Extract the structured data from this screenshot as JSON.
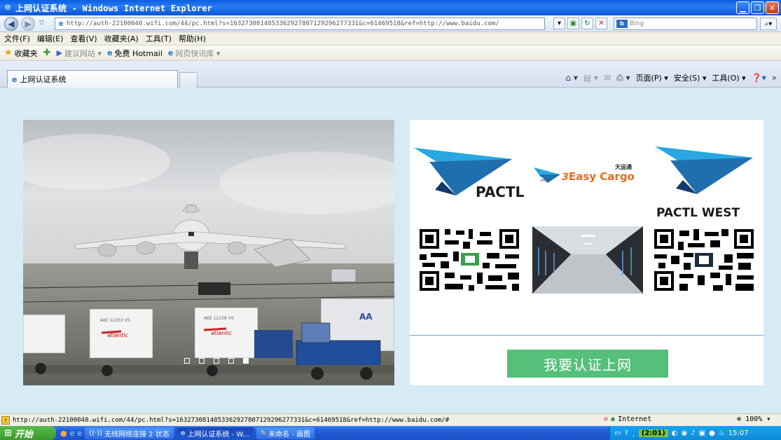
{
  "window": {
    "title": "上网认证系统 - Windows Internet Explorer",
    "controls": [
      "minimize",
      "restore",
      "close"
    ]
  },
  "address_bar": {
    "url": "http://auth-22100040.wifi.com/44/pc.html?s=1632730814853362927807129296277331&c=61469518&ref=http://www.baidu.com/",
    "search_engine": "Bing"
  },
  "menu": {
    "items": [
      "文件(F)",
      "编辑(E)",
      "查看(V)",
      "收藏夹(A)",
      "工具(T)",
      "帮助(H)"
    ]
  },
  "favorites_bar": {
    "favorites_label": "收藏夹",
    "links": [
      "建议网站 ▾",
      "免费 Hotmail",
      "网页快讯库 ▾"
    ]
  },
  "tab": {
    "title": "上网认证系统"
  },
  "command_bar": {
    "page_label": "页面(P) ▾",
    "safety_label": "安全(S) ▾",
    "tools_label": "工具(O) ▾"
  },
  "content": {
    "slider_dots": 5,
    "slider_active_index": 4,
    "logos": {
      "pactl": "PACTL",
      "easy_cargo": "Easy Cargo",
      "easy_cargo_cn": "天运通",
      "easy_cargo_prefix": "PACTL",
      "pactl_west": "PACTL WEST"
    },
    "cargo_labels": {
      "container1": "AKE 12353 VS",
      "container2": "AKE 12158 VS",
      "brand": "atlantic",
      "aa": "AA"
    },
    "auth_button": "我要认证上网"
  },
  "status_bar": {
    "url": "http://auth-22100040.wifi.com/44/pc.html?s=1632730814853362927807129296277331&c=61469518&ref=http://www.baidu.com/#",
    "zone": "Internet",
    "zoom": "100%"
  },
  "taskbar": {
    "start_label": "开始",
    "items": [
      "无线网络连接 2 状态",
      "上网认证系统 - W...",
      "未命名 - 画图"
    ],
    "active_index": 1,
    "timer": "(2:01)",
    "clock": "15:07"
  },
  "colors": {
    "auth_button": "#55c07a",
    "page_background": "#d7ebf4",
    "pactl_blue": "#1f6fae"
  }
}
